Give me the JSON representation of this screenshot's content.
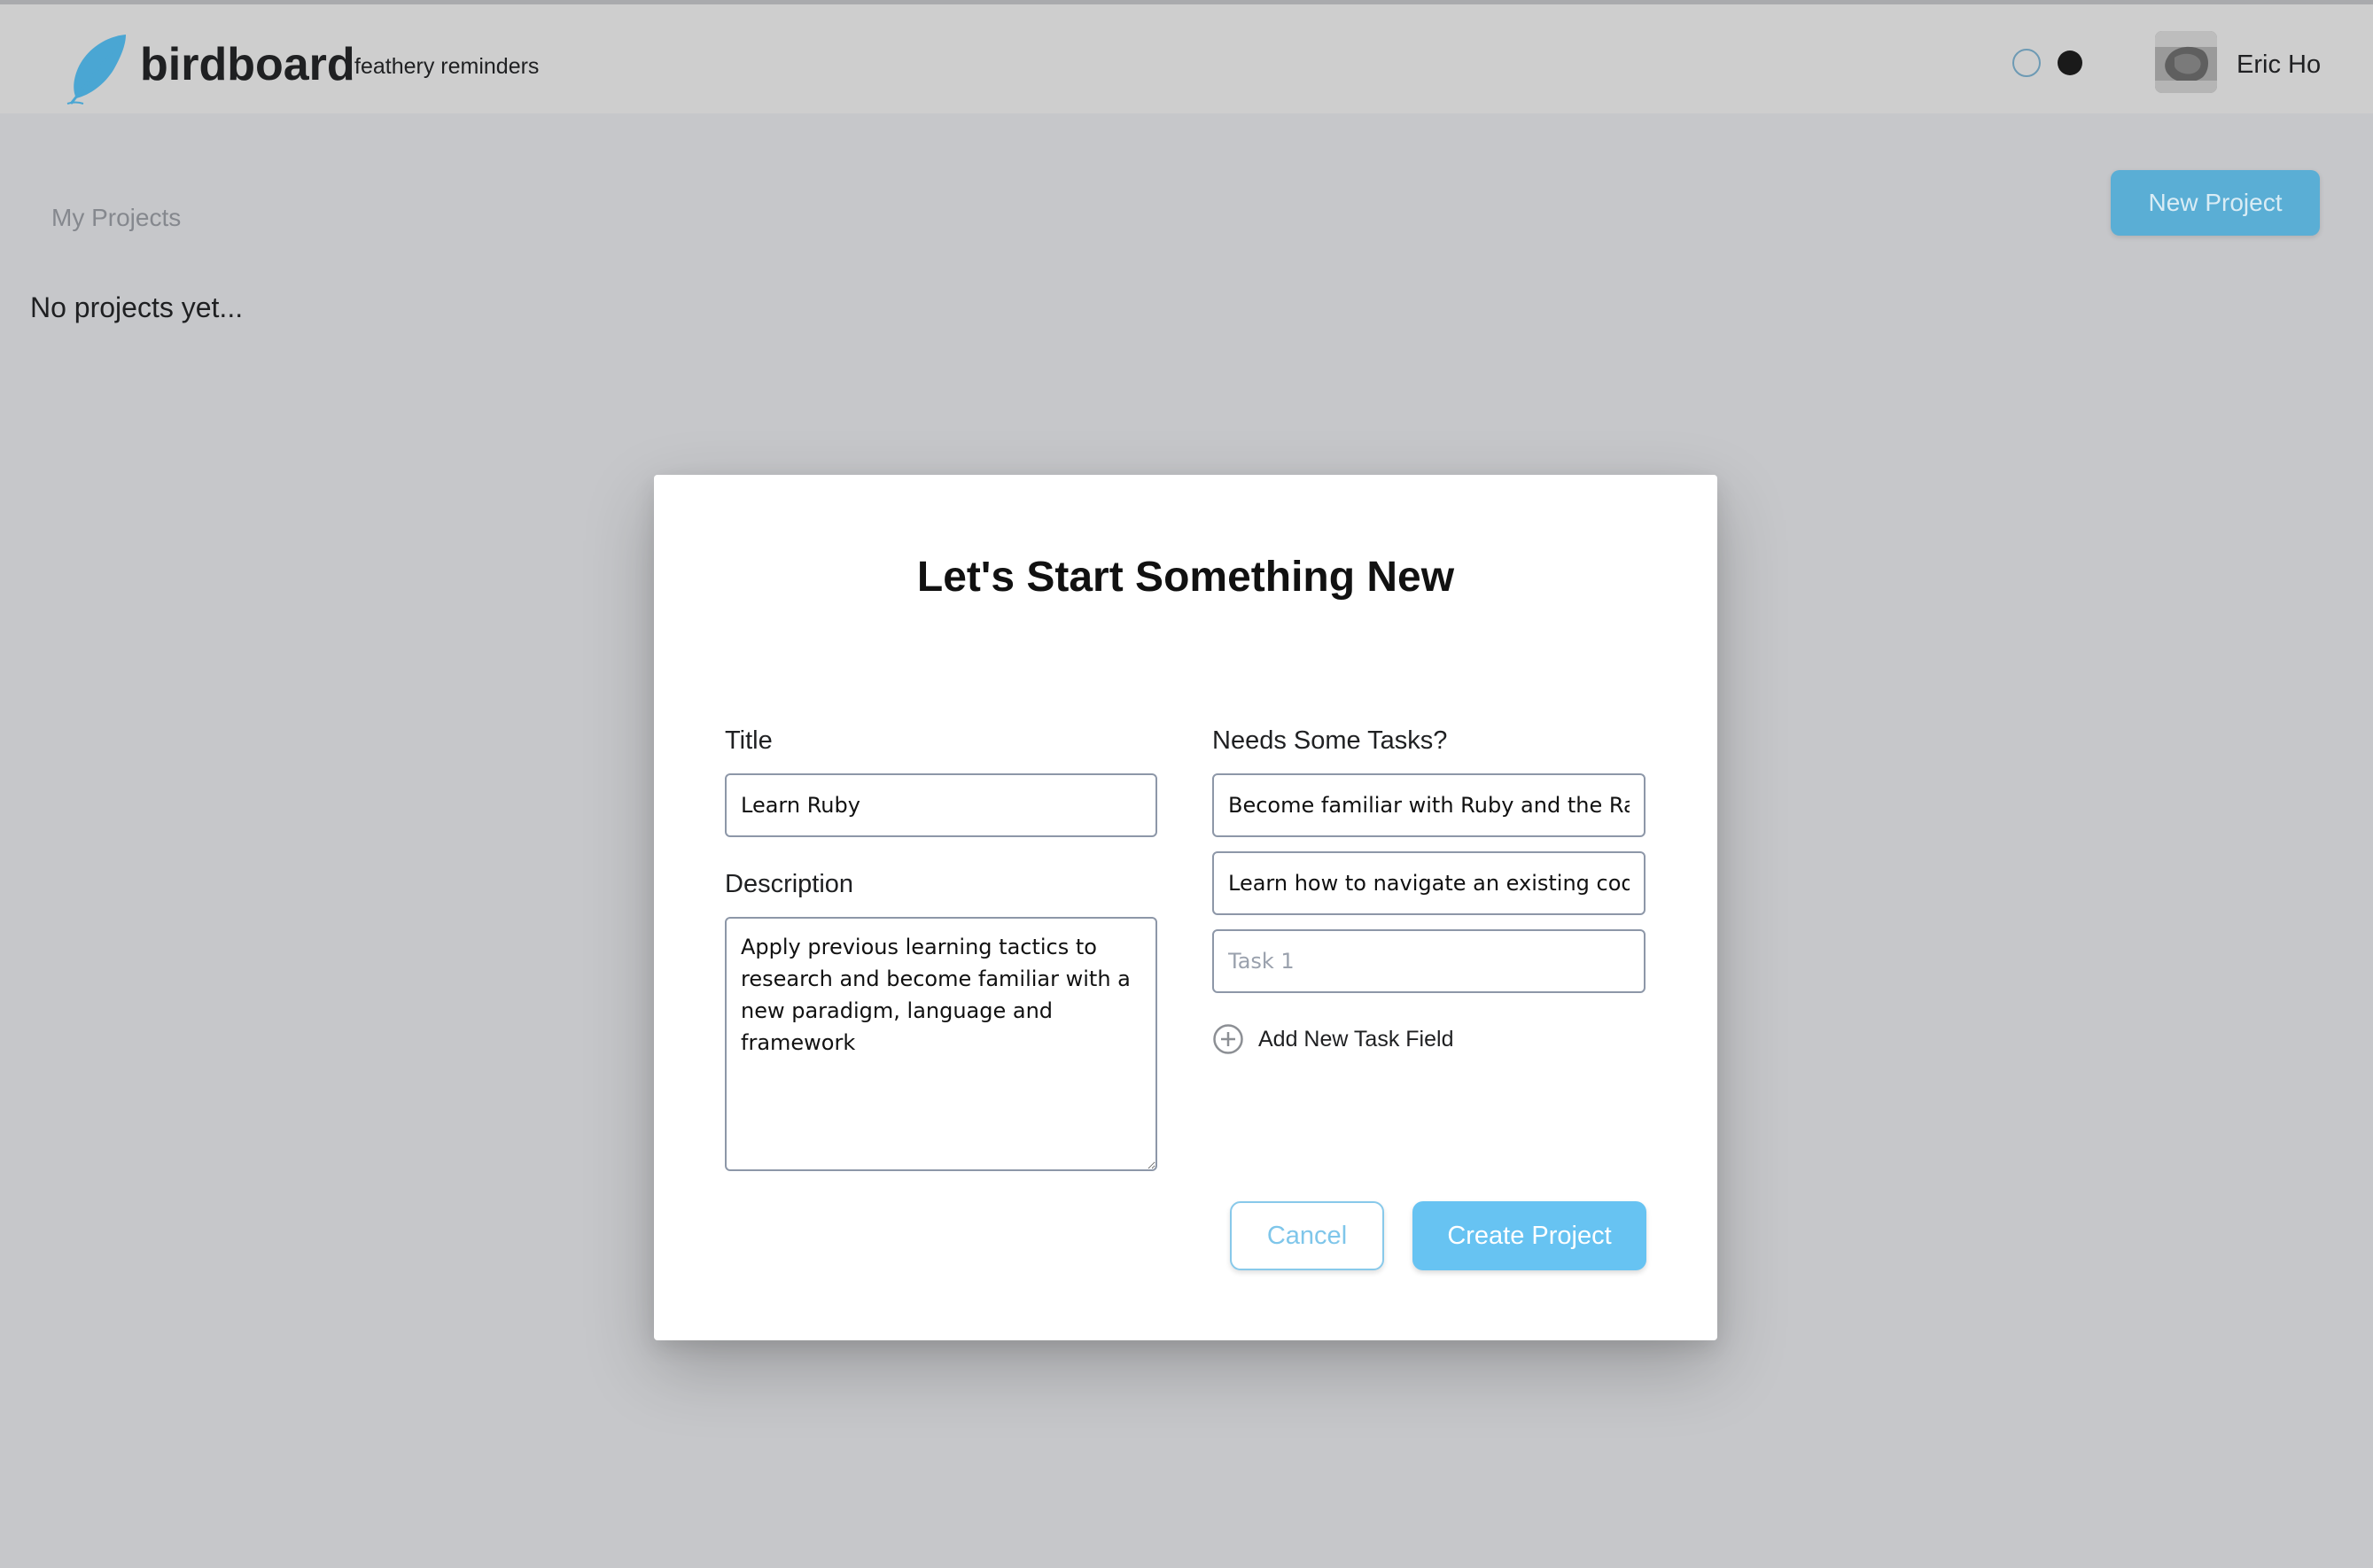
{
  "header": {
    "brand": "birdboard",
    "tagline": "feathery reminders",
    "user_name": "Eric Ho",
    "icons": {
      "logo": "feather-icon",
      "theme_light": "light-theme-toggle",
      "theme_dark": "dark-theme-toggle",
      "avatar": "user-avatar"
    }
  },
  "main": {
    "heading": "My Projects",
    "new_project_label": "New Project",
    "empty_message": "No projects yet..."
  },
  "modal": {
    "title": "Let's Start Something New",
    "title_label": "Title",
    "title_value": "Learn Ruby",
    "description_label": "Description",
    "description_value": "Apply previous learning tactics to research and become familiar with a new paradigm, language and framework",
    "tasks_label": "Needs Some Tasks?",
    "tasks": [
      {
        "value": "Become familiar with Ruby and the Rails",
        "placeholder": ""
      },
      {
        "value": "Learn how to navigate an existing code-",
        "placeholder": ""
      },
      {
        "value": "",
        "placeholder": "Task 1"
      }
    ],
    "add_task_label": "Add New Task Field",
    "cancel_label": "Cancel",
    "create_label": "Create Project"
  },
  "colors": {
    "accent": "#67c3f2",
    "button_blue": "#5aaed5",
    "background": "#c6c7ca",
    "navbar": "#cecece"
  }
}
